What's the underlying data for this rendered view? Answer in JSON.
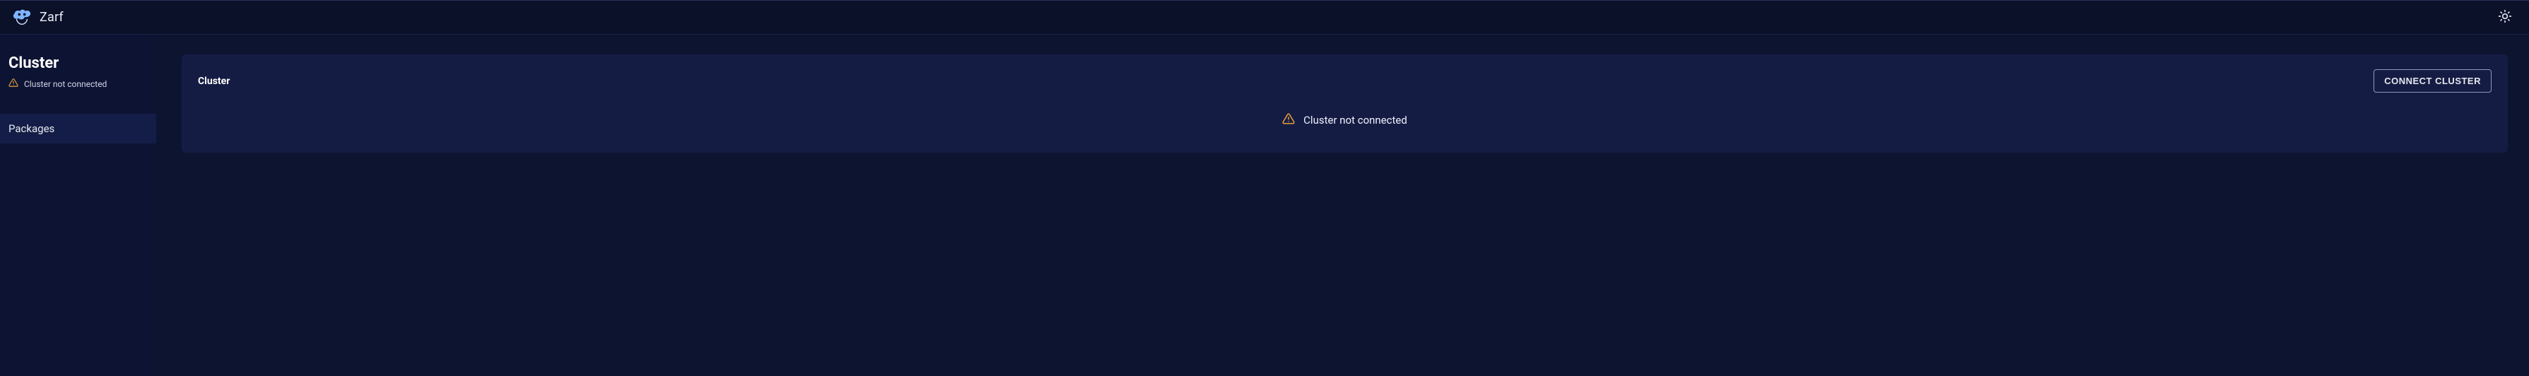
{
  "brand": {
    "name": "Zarf"
  },
  "header": {
    "theme_toggle_label": "Toggle theme"
  },
  "sidebar": {
    "title": "Cluster",
    "status_text": "Cluster not connected",
    "nav": [
      {
        "label": "Packages",
        "active": true
      }
    ]
  },
  "main": {
    "panel": {
      "title": "Cluster",
      "connect_button": "CONNECT CLUSTER",
      "status_text": "Cluster not connected"
    }
  }
}
